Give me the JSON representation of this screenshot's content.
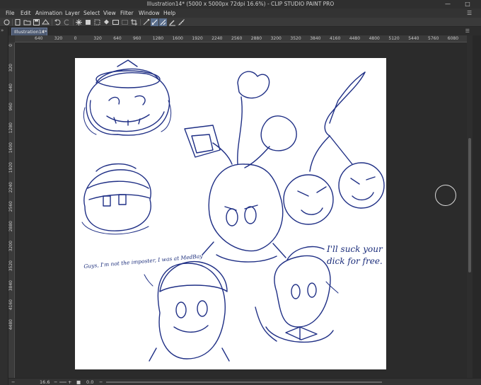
{
  "window": {
    "title": "Illustration14* (5000 x 5000px 72dpi 16.6%) - CLIP STUDIO PAINT PRO",
    "controls": [
      "—",
      "□"
    ]
  },
  "menu": {
    "items": [
      "File",
      "Edit",
      "Animation",
      "Layer",
      "Select",
      "View",
      "Filter",
      "Window",
      "Help"
    ]
  },
  "toolbar": {
    "buttons": [
      "new",
      "open",
      "save",
      "undo",
      "redo",
      "clear",
      "fill",
      "transform",
      "snap-ruler",
      "snap-grid",
      "snap-special",
      "pen-pressure",
      "stabilizer"
    ]
  },
  "document": {
    "tab_label": "Illustration14*",
    "close_glyph": "×"
  },
  "rulers": {
    "top": [
      "640",
      "320",
      "0",
      "320",
      "640",
      "960",
      "1280",
      "1600",
      "1920",
      "2240",
      "2560",
      "2880",
      "3200",
      "3520",
      "3840",
      "4160",
      "4480",
      "4800",
      "5120",
      "5440",
      "5760",
      "6080"
    ],
    "left": [
      "0",
      "320",
      "640",
      "960",
      "1280",
      "1600",
      "1920",
      "2240",
      "2560",
      "2880",
      "3200",
      "3520",
      "3840",
      "4160",
      "4480"
    ]
  },
  "canvas": {
    "background": "#ffffff",
    "ink_color": "#1f2f85",
    "caption_small": "Guys, I'm not the imposter, I was at MedBay",
    "caption_big": "I'll suck your\ndick for free."
  },
  "status": {
    "zoom": "16.6",
    "rotation": "0.0"
  },
  "colors": {
    "ui_dark": "#2b2b2b",
    "tab_active": "#4d5a72",
    "button_active": "#5a6e8c"
  }
}
